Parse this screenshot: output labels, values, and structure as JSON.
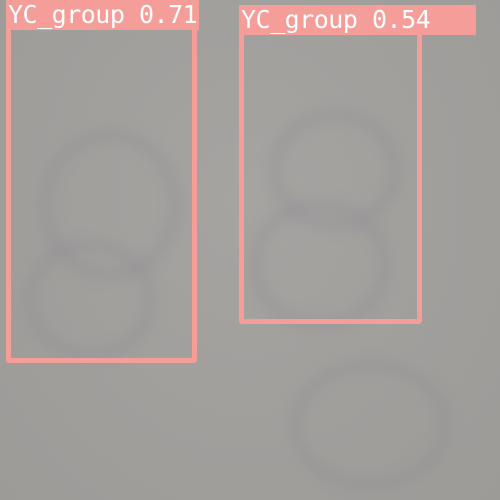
{
  "detections": [
    {
      "label": "YC_group 0.71"
    },
    {
      "label": "YC_group 0.54"
    }
  ],
  "colors": {
    "box": "#f59d99",
    "label_text": "#ffffff",
    "background": "#a3a19e"
  }
}
